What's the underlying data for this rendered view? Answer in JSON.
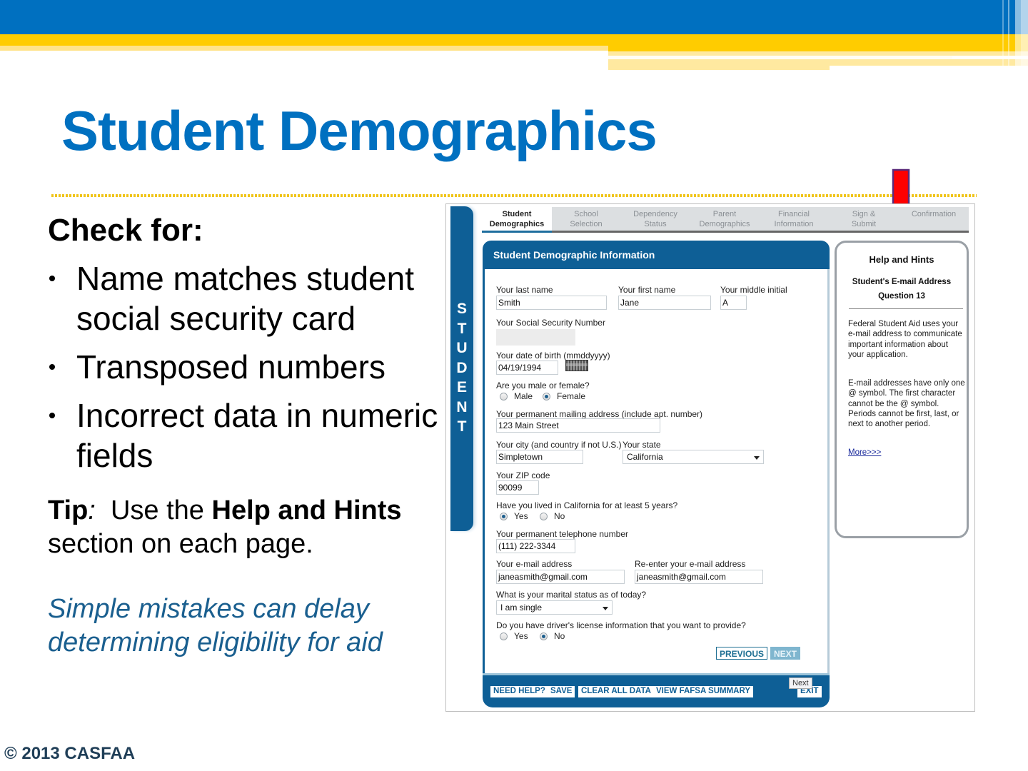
{
  "slide": {
    "title": "Student Demographics",
    "check_heading": "Check for:",
    "bullets": [
      "Name matches student social security card",
      "Transposed numbers",
      "Incorrect data in numeric fields"
    ],
    "tip_label": "Tip",
    "tip_colon": ":",
    "tip_text_1": "  Use the ",
    "tip_bold": "Help and Hints",
    "tip_text_2": " section on each page.",
    "tip_italic": "Simple mistakes can delay determining eligibility for aid",
    "copyright": "© 2013 CASFAA",
    "colors": {
      "brand_blue": "#0070c0",
      "brand_yellow": "#ffcc00",
      "fafsa_blue": "#0e5f96",
      "arrow_red": "#ff0000"
    }
  },
  "fafsa": {
    "side_tab_letters": [
      "S",
      "T",
      "U",
      "D",
      "E",
      "N",
      "T"
    ],
    "steps": [
      {
        "line1": "Student",
        "line2": "Demographics",
        "active": true
      },
      {
        "line1": "School",
        "line2": "Selection",
        "active": false
      },
      {
        "line1": "Dependency",
        "line2": "Status",
        "active": false
      },
      {
        "line1": "Parent",
        "line2": "Demographics",
        "active": false
      },
      {
        "line1": "Financial",
        "line2": "Information",
        "active": false
      },
      {
        "line1": "Sign &",
        "line2": "Submit",
        "active": false
      },
      {
        "line1": "Confirmation",
        "line2": "",
        "active": false
      }
    ],
    "panel_title": "Student Demographic Information",
    "form": {
      "last_name_label": "Your last name",
      "last_name": "Smith",
      "first_name_label": "Your first name",
      "first_name": "Jane",
      "middle_initial_label": "Your middle initial",
      "middle_initial": "A",
      "ssn_label": "Your Social Security Number",
      "ssn": "",
      "dob_label": "Your date of birth (mmddyyyy)",
      "dob": "04/19/1994",
      "gender_label": "Are you male or female?",
      "gender_options": [
        "Male",
        "Female"
      ],
      "gender_selected": "Female",
      "address_label": "Your permanent mailing address (include apt. number)",
      "address": "123 Main Street",
      "city_label": "Your city (and country if not U.S.)",
      "city": "Simpletown",
      "state_label": "Your state",
      "state": "California",
      "zip_label": "Your ZIP code",
      "zip": "90099",
      "lived5_label": "Have you lived in California for at least 5 years?",
      "lived5_options": [
        "Yes",
        "No"
      ],
      "lived5_selected": "Yes",
      "phone_label": "Your permanent telephone number",
      "phone": "(111) 222-3344",
      "email_label": "Your e-mail address",
      "email": "janeasmith@gmail.com",
      "email2_label": "Re-enter your e-mail address",
      "email2": "janeasmith@gmail.com",
      "marital_label": "What is your marital status as of today?",
      "marital": "I am single",
      "license_label": "Do you have driver's license information that you want to provide?",
      "license_options": [
        "Yes",
        "No"
      ],
      "license_selected": "No"
    },
    "nav": {
      "previous": "PREVIOUS",
      "next": "NEXT"
    },
    "footer_buttons": [
      "NEED HELP?",
      "SAVE",
      "CLEAR ALL DATA",
      "VIEW FAFSA SUMMARY",
      "EXIT"
    ],
    "tooltip": "Next",
    "help": {
      "title": "Help and Hints",
      "subtitle": "Student's E-mail Address",
      "question": "Question 13",
      "para1": "Federal Student Aid uses your e-mail address to communicate important information about your application.",
      "para2": "E-mail addresses have only one @ symbol. The first character cannot be the @ symbol. Periods cannot be first, last, or next to another period.",
      "more_link": "More>>>"
    }
  }
}
